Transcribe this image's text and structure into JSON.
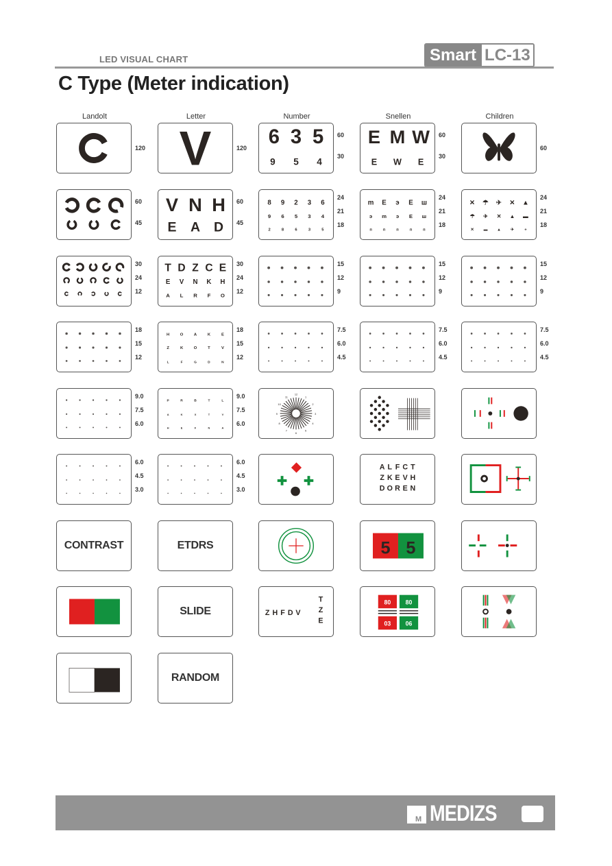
{
  "header": {
    "section": "LED VISUAL CHART",
    "brand_left": "Smart",
    "brand_right": "LC-13",
    "page_title": "C Type (Meter indication)"
  },
  "columns": [
    "Landolt",
    "Letter",
    "Number",
    "Snellen",
    "Children"
  ],
  "colors": {
    "red": "#e02020",
    "green": "#12923f",
    "dark": "#2b2522",
    "border": "#555555",
    "footer": "#939393"
  },
  "cards": {
    "r1": {
      "landolt": {
        "labels": [
          "120"
        ]
      },
      "letter": {
        "glyphs": "V",
        "labels": [
          "120"
        ]
      },
      "number": {
        "rows": [
          "635",
          "954"
        ],
        "labels": [
          "60",
          "30"
        ]
      },
      "snellen": {
        "rows": [
          "EMW",
          "EWE"
        ],
        "labels": [
          "60",
          "30"
        ]
      },
      "children": {
        "symbol": "butterfly",
        "labels": [
          "60"
        ]
      }
    },
    "r2": {
      "landolt": {
        "labels": [
          "60",
          "45"
        ]
      },
      "letter": {
        "rows": [
          "VNH",
          "EAD"
        ],
        "labels": [
          "60",
          "45"
        ]
      },
      "number": {
        "rows": [
          "89236",
          "96534",
          "28635"
        ],
        "labels": [
          "24",
          "21",
          "18"
        ]
      },
      "snellen": {
        "labels": [
          "24",
          "21",
          "18"
        ]
      },
      "children": {
        "labels": [
          "24",
          "21",
          "18"
        ]
      }
    },
    "r3": {
      "landolt": {
        "labels": [
          "30",
          "24",
          "12"
        ]
      },
      "letter": {
        "rows": [
          "TDZCE",
          "EVNKH",
          "ALRFO"
        ],
        "labels": [
          "30",
          "24",
          "12"
        ]
      },
      "number": {
        "labels": [
          "15",
          "12",
          "9"
        ]
      },
      "snellen": {
        "labels": [
          "15",
          "12",
          "9"
        ]
      },
      "children": {
        "labels": [
          "15",
          "12",
          "9"
        ]
      }
    },
    "r4": {
      "landolt": {
        "labels": [
          "18",
          "15",
          "12"
        ]
      },
      "letter": {
        "rows": [
          "HOAKE",
          "ZKOTV",
          "LFGDN"
        ],
        "labels": [
          "18",
          "15",
          "12"
        ]
      },
      "number": {
        "labels": [
          "7.5",
          "6.0",
          "4.5"
        ]
      },
      "snellen": {
        "labels": [
          "7.5",
          "6.0",
          "4.5"
        ]
      },
      "children": {
        "labels": [
          "7.5",
          "6.0",
          "4.5"
        ]
      }
    },
    "r5": {
      "landolt": {
        "labels": [
          "9.0",
          "7.5",
          "6.0"
        ]
      },
      "letter": {
        "rows": [
          "PRBTL",
          "AKXTV",
          "HEFNA"
        ],
        "labels": [
          "9.0",
          "7.5",
          "6.0"
        ]
      },
      "astigmatism": {
        "clock": [
          "12",
          "1",
          "2",
          "3",
          "4",
          "5",
          "6",
          "7",
          "8",
          "9",
          "10",
          "11"
        ]
      },
      "dots_cross": {
        "name": "dot-and-grid"
      },
      "red_green_cross": {
        "name": "cross-fixation"
      }
    },
    "r6": {
      "landolt": {
        "labels": [
          "6.0",
          "4.5",
          "3.0"
        ]
      },
      "letter": {
        "labels": [
          "6.0",
          "4.5",
          "3.0"
        ]
      },
      "worth": {
        "name": "worth-four-dot"
      },
      "letter_block": {
        "rows": [
          "ALFCT",
          "ZKEVH",
          "DOREN"
        ]
      },
      "square_cross": {
        "name": "square-fixation"
      }
    },
    "r7": {
      "contrast": "CONTRAST",
      "etdrs": "ETDRS",
      "ring_cross": {
        "name": "ring-cross"
      },
      "duochrome55": {
        "digits": [
          "5",
          "5"
        ]
      },
      "dash_cross": {
        "name": "dash-cross"
      }
    },
    "r8": {
      "red_green": {
        "name": "red-green"
      },
      "slide": "SLIDE",
      "zhfdv": {
        "row": "ZHFDV",
        "col": [
          "T",
          "Z",
          "E"
        ]
      },
      "duochrome_boxes": {
        "top": [
          "80",
          "80"
        ],
        "bottom": [
          "03",
          "06"
        ]
      },
      "polarized": {
        "name": "polarized-test"
      }
    },
    "r9": {
      "white_black": {
        "name": "white-black"
      },
      "random": "RANDOM"
    }
  },
  "footer": {
    "logo": "MEDIZS",
    "mark": "M"
  }
}
